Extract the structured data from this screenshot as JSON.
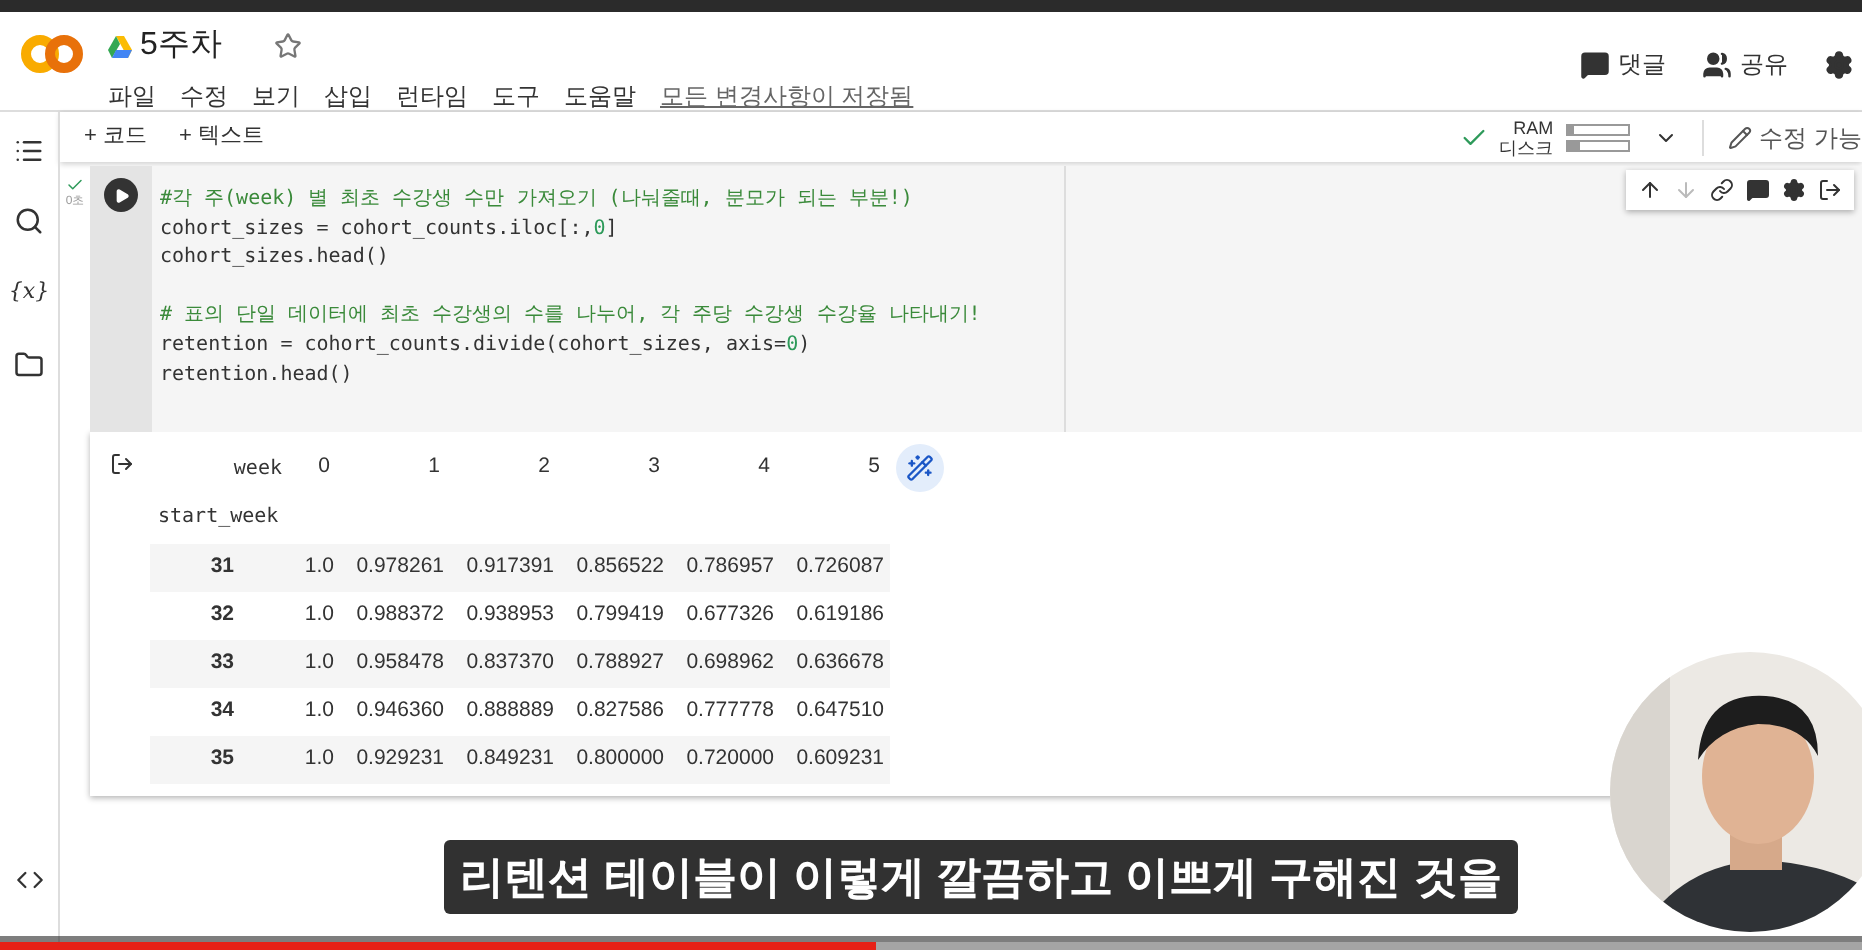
{
  "header": {
    "title": "5주차",
    "starred": false,
    "menu": [
      "파일",
      "수정",
      "보기",
      "삽입",
      "런타임",
      "도구",
      "도움말"
    ],
    "save_status": "모든 변경사항이 저장됨",
    "comment": "댓글",
    "share": "공유"
  },
  "toolbar": {
    "add_buttons": [
      "+ 코드",
      "+ 텍스트"
    ],
    "ram": {
      "label": "RAM",
      "level": 0.1
    },
    "disk": {
      "label": "디스크",
      "level": 0.2
    },
    "edit_mode": "수정 가능"
  },
  "cell": {
    "exec_time": "0초",
    "lines": [
      [
        {
          "kind": "comment",
          "text": "#각 주(week) 별 최초 수강생 수만 가져오기 (나눠줄때, 분모가 되는 부분!)"
        }
      ],
      [
        {
          "kind": "code",
          "text": "cohort_sizes = cohort_counts.iloc[:,"
        },
        {
          "kind": "number",
          "text": "0"
        },
        {
          "kind": "code",
          "text": "]"
        }
      ],
      [
        {
          "kind": "code",
          "text": "cohort_sizes.head()"
        }
      ],
      [
        {
          "kind": "blank"
        }
      ],
      [
        {
          "kind": "comment",
          "text": "# 표의 단일 데이터에 최초 수강생의 수를 나누어, 각 주당 수강생 수강율 나타내기!"
        }
      ],
      [
        {
          "kind": "code",
          "text": "retention = cohort_counts.divide(cohort_sizes, axis="
        },
        {
          "kind": "number",
          "text": "0"
        },
        {
          "kind": "code",
          "text": ")"
        }
      ],
      [
        {
          "kind": "code",
          "text": "retention.head()"
        }
      ]
    ]
  },
  "output": {
    "columns_label": "week",
    "columns": [
      "0",
      "1",
      "2",
      "3",
      "4",
      "5"
    ],
    "index_label": "start_week",
    "rows": [
      {
        "index": "31",
        "values": [
          "1.0",
          "0.978261",
          "0.917391",
          "0.856522",
          "0.786957",
          "0.726087"
        ]
      },
      {
        "index": "32",
        "values": [
          "1.0",
          "0.988372",
          "0.938953",
          "0.799419",
          "0.677326",
          "0.619186"
        ]
      },
      {
        "index": "33",
        "values": [
          "1.0",
          "0.958478",
          "0.837370",
          "0.788927",
          "0.698962",
          "0.636678"
        ]
      },
      {
        "index": "34",
        "values": [
          "1.0",
          "0.946360",
          "0.888889",
          "0.827586",
          "0.777778",
          "0.647510"
        ]
      },
      {
        "index": "35",
        "values": [
          "1.0",
          "0.929231",
          "0.849231",
          "0.800000",
          "0.720000",
          "0.609231"
        ]
      }
    ]
  },
  "sidebar": {
    "variables_label": "{x}"
  },
  "subtitle": "리텐션 테이블이 이렇게 깔끔하고 이쁘게 구해진 것을",
  "video": {
    "level": 0.47
  }
}
